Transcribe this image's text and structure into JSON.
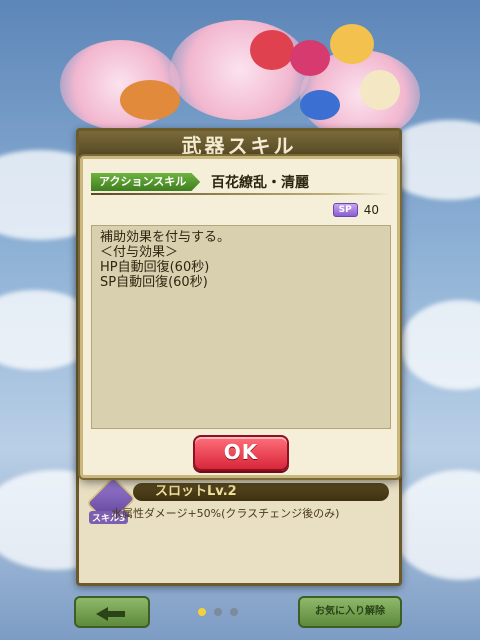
{
  "base_panel": {
    "title": "武器スキル",
    "skill3": {
      "badge": "スキル3",
      "slot_label": "スロットLv.2",
      "description": "水属性ダメージ+50%(クラスチェンジ後のみ)"
    },
    "ok_label": "OK"
  },
  "modal": {
    "skill_type": "アクションスキル",
    "skill_name": "百花繚乱・清麗",
    "sp_badge": "SP",
    "sp_value": "40",
    "description_lines": [
      "補助効果を付与する。",
      "",
      "＜付与効果＞",
      "HP自動回復(60秒)",
      "SP自動回復(60秒)"
    ],
    "ok_label": "OK"
  },
  "bottom_bar": {
    "favorite_label": "お気に入り解除",
    "pages": 3,
    "active_page": 1
  },
  "colors": {
    "modal_bg": "#f5efd9",
    "desc_bg": "#d8d0ae",
    "ok_button": "#d9263a",
    "skill_tag": "#3f7d1f",
    "sp_badge": "#8a5fd0"
  }
}
